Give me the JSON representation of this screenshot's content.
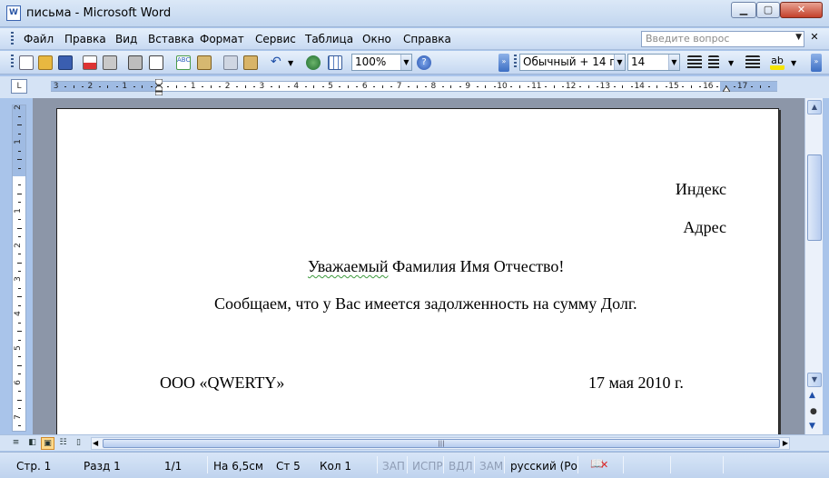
{
  "window": {
    "title": "письма - Microsoft Word",
    "app_icon": "W"
  },
  "menu": [
    "Файл",
    "Правка",
    "Вид",
    "Вставка",
    "Формат",
    "Сервис",
    "Таблица",
    "Окно",
    "Справка"
  ],
  "help_placeholder": "Введите вопрос",
  "toolbar": {
    "zoom": "100%",
    "style": "Обычный + 14 пт,",
    "font_size": "14"
  },
  "ruler": {
    "h_labels": [
      "3",
      "2",
      "1",
      "1",
      "2",
      "3",
      "4",
      "5",
      "6",
      "7",
      "8",
      "9",
      "10",
      "11",
      "12",
      "13",
      "14",
      "15",
      "16",
      "17"
    ],
    "v_labels": [
      "2",
      "1",
      "1",
      "2",
      "3",
      "4",
      "5",
      "6",
      "7"
    ]
  },
  "document": {
    "index": "Индекс",
    "address": "Адрес",
    "greeting_word": "Уважаемый",
    "greeting_rest": " Фамилия Имя Отчество!",
    "body": "Сообщаем, что у Вас имеется задолженность на сумму  Долг.",
    "company": "ООО «QWERTY»",
    "date": "17 мая 2010 г."
  },
  "status": {
    "page": "Стр. 1",
    "section": "Разд 1",
    "pages": "1/1",
    "position": "На 6,5см",
    "line": "Ст 5",
    "column": "Кол 1",
    "rec": "ЗАП",
    "trk": "ИСПР",
    "ext": "ВДЛ",
    "ovr": "ЗАМ",
    "language": "русский (Ро"
  }
}
